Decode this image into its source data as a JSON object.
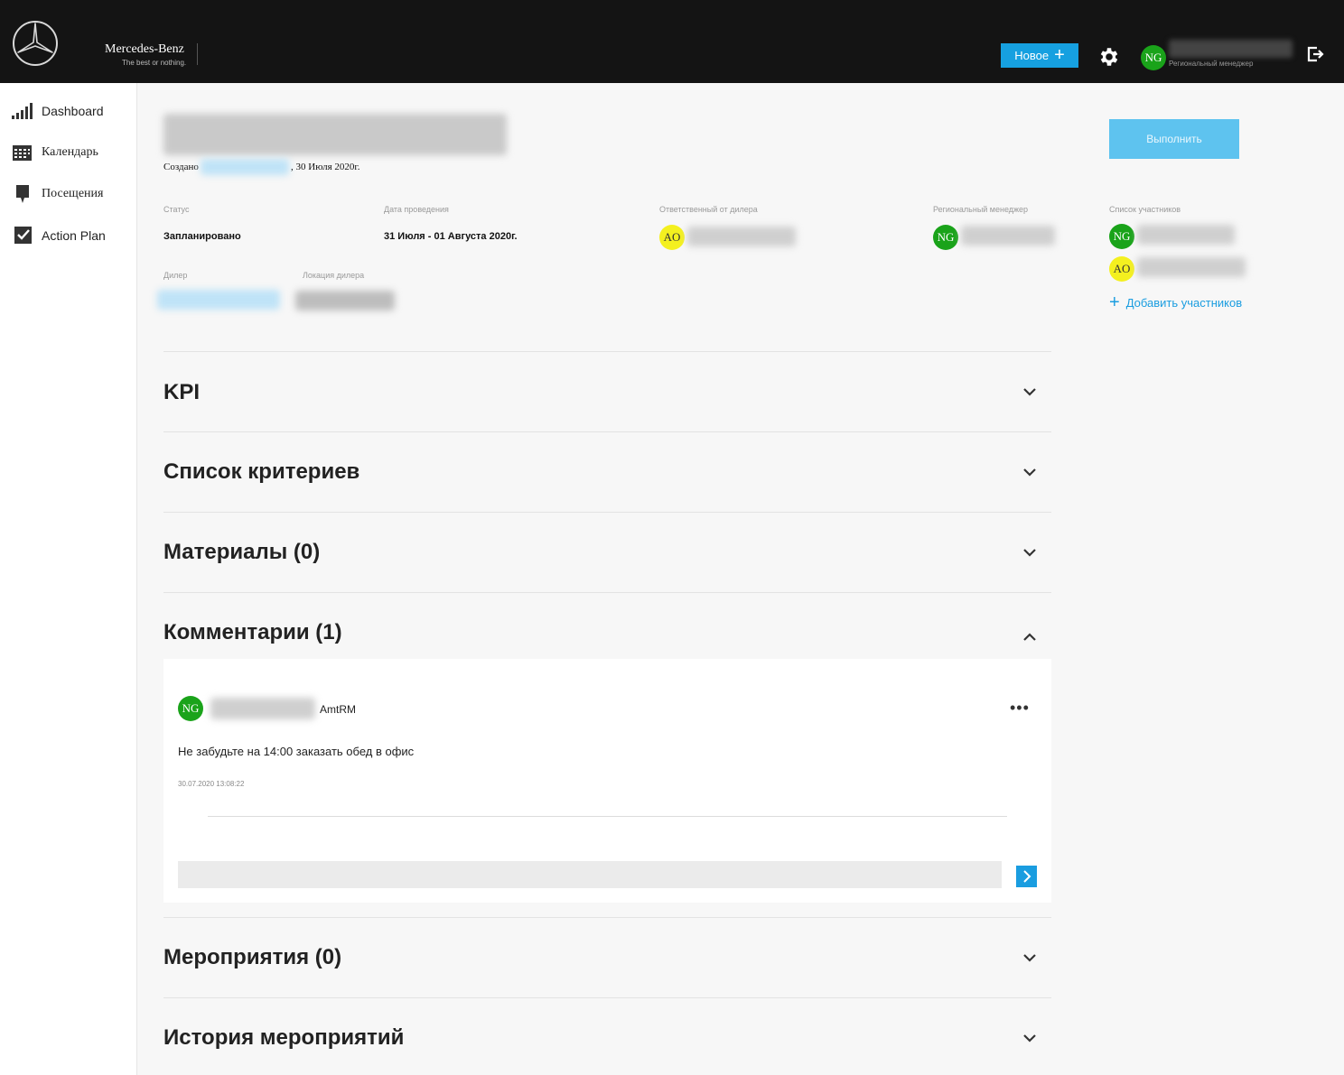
{
  "header": {
    "brand": "Mercedes-Benz",
    "tagline": "The best or nothing.",
    "new_button": "Новое",
    "user_initials": "NG",
    "user_role": "Региональный менеджер"
  },
  "sidebar": {
    "items": [
      {
        "label": "Dashboard",
        "icon": "bar-chart-icon"
      },
      {
        "label": "Календарь",
        "icon": "calendar-icon"
      },
      {
        "label": "Посещения",
        "icon": "pin-icon"
      },
      {
        "label": "Action Plan",
        "icon": "checkbox-icon"
      }
    ]
  },
  "meta": {
    "created_label": "Создано",
    "created_date": ", 30 Июля 2020г.",
    "status_label": "Статус",
    "status_value": "Запланировано",
    "date_label": "Дата проведения",
    "date_value": "31 Июля - 01 Августа 2020г.",
    "dealer_resp_label": "Ответственный от дилера",
    "dealer_resp_initials": "AO",
    "regional_label": "Региональный менеджер",
    "regional_initials": "NG",
    "dealer_label": "Дилер",
    "dealer_location_label": "Локация дилера",
    "participants_label": "Список участников",
    "participants": [
      {
        "initials": "NG"
      },
      {
        "initials": "AO"
      }
    ],
    "add_participants": "Добавить участников",
    "run_button": "Выполнить"
  },
  "sections": [
    {
      "title": "KPI",
      "expanded": false
    },
    {
      "title": "Список критериев",
      "expanded": false
    },
    {
      "title": "Материалы (0)",
      "expanded": false
    },
    {
      "title": "Комментарии (1)",
      "expanded": true
    },
    {
      "title": "Мероприятия (0)",
      "expanded": false
    },
    {
      "title": "История мероприятий",
      "expanded": false
    }
  ],
  "comment": {
    "initials": "NG",
    "role": "AmtRM",
    "text": "Не забудьте на 14:00 заказать обед в офис",
    "timestamp": "30.07.2020 13:08:22",
    "more": "•••"
  },
  "colors": {
    "accent": "#16a0e0",
    "avatar_green": "#1aa31a",
    "avatar_yellow": "#f4f01f",
    "header_bg": "#141414"
  }
}
